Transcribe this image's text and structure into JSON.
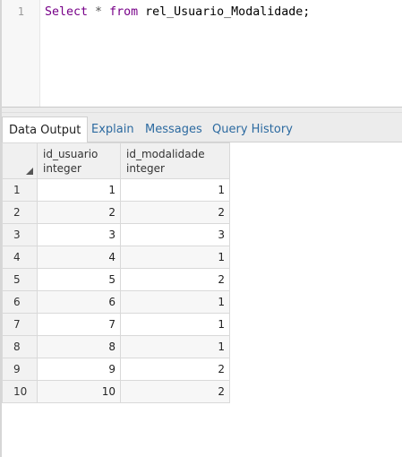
{
  "editor": {
    "line_number": "1",
    "query": {
      "kw_select": "Select",
      "star": " * ",
      "kw_from": "from",
      "rest": " rel_Usuario_Modalidade;"
    }
  },
  "tabs": [
    {
      "label": "Data Output",
      "active": true
    },
    {
      "label": "Explain",
      "active": false
    },
    {
      "label": "Messages",
      "active": false
    },
    {
      "label": "Query History",
      "active": false
    }
  ],
  "columns": [
    {
      "name": "id_usuario",
      "type": "integer"
    },
    {
      "name": "id_modalidade",
      "type": "integer"
    }
  ],
  "rows": [
    {
      "n": "1",
      "id_usuario": "1",
      "id_modalidade": "1"
    },
    {
      "n": "2",
      "id_usuario": "2",
      "id_modalidade": "2"
    },
    {
      "n": "3",
      "id_usuario": "3",
      "id_modalidade": "3"
    },
    {
      "n": "4",
      "id_usuario": "4",
      "id_modalidade": "1"
    },
    {
      "n": "5",
      "id_usuario": "5",
      "id_modalidade": "2"
    },
    {
      "n": "6",
      "id_usuario": "6",
      "id_modalidade": "1"
    },
    {
      "n": "7",
      "id_usuario": "7",
      "id_modalidade": "1"
    },
    {
      "n": "8",
      "id_usuario": "8",
      "id_modalidade": "1"
    },
    {
      "n": "9",
      "id_usuario": "9",
      "id_modalidade": "2"
    },
    {
      "n": "10",
      "id_usuario": "10",
      "id_modalidade": "2"
    }
  ]
}
